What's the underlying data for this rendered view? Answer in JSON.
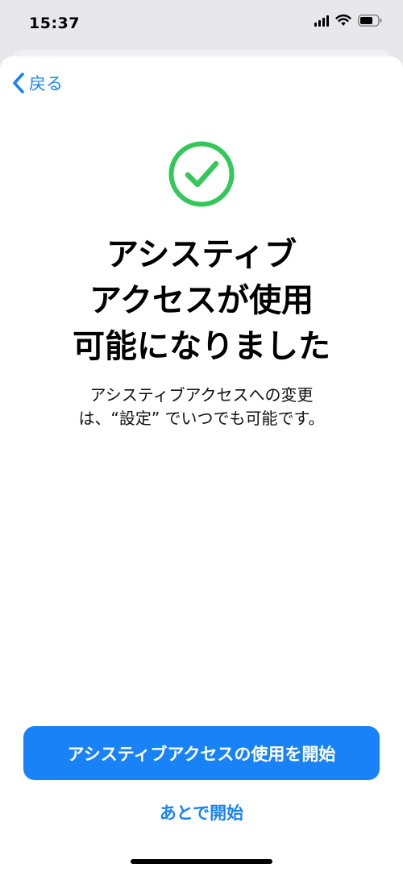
{
  "status_bar": {
    "time": "15:37",
    "icons": [
      "signal-icon",
      "wifi-icon",
      "battery-icon"
    ]
  },
  "nav": {
    "back_label": "戻る",
    "back_icon": "chevron-left-icon"
  },
  "success_icon": {
    "name": "checkmark-circle-icon",
    "color": "#34c759"
  },
  "title_lines": [
    "アシスティブ",
    "アクセスが使用",
    "可能になりました"
  ],
  "description_lines": [
    "アシスティブアクセスへの変更",
    "は、“設定” でいつでも可能です。"
  ],
  "primary_button": {
    "label": "アシスティブアクセスの使用を開始",
    "color": "#1a82f7"
  },
  "secondary_button": {
    "label": "あとで開始"
  }
}
